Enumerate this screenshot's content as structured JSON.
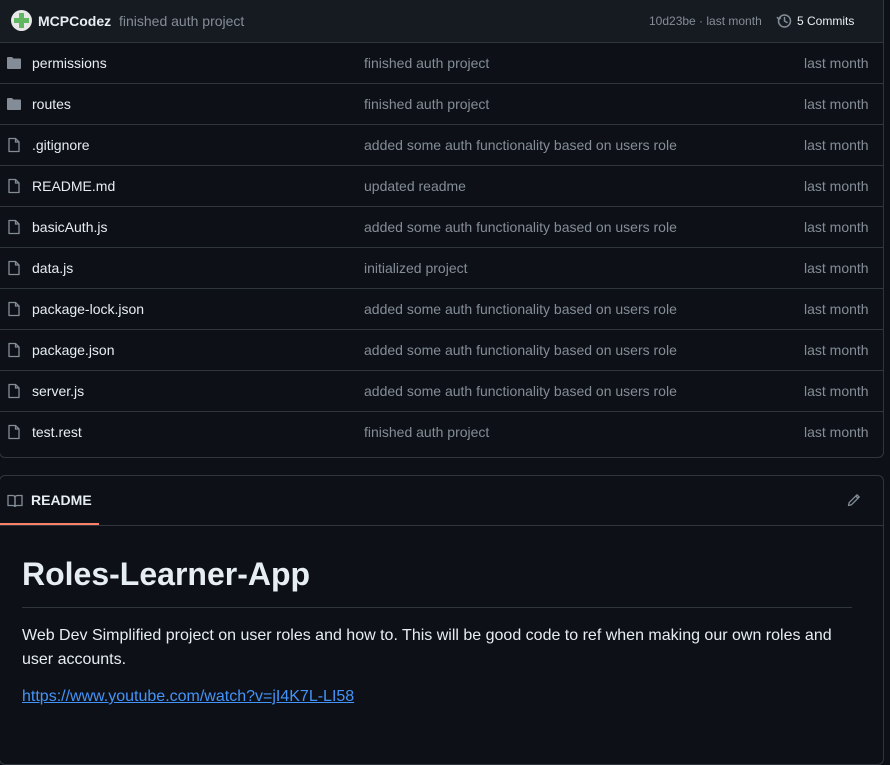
{
  "commit_bar": {
    "author": "MCPCodez",
    "message": "finished auth project",
    "meta": "10d23be · last month",
    "commits_label": "5 Commits"
  },
  "files": [
    {
      "type": "folder",
      "name": "permissions",
      "message": "finished auth project",
      "time": "last month"
    },
    {
      "type": "folder",
      "name": "routes",
      "message": "finished auth project",
      "time": "last month"
    },
    {
      "type": "file",
      "name": ".gitignore",
      "message": "added some auth functionality based on users role",
      "time": "last month"
    },
    {
      "type": "file",
      "name": "README.md",
      "message": "updated readme",
      "time": "last month"
    },
    {
      "type": "file",
      "name": "basicAuth.js",
      "message": "added some auth functionality based on users role",
      "time": "last month"
    },
    {
      "type": "file",
      "name": "data.js",
      "message": "initialized project",
      "time": "last month"
    },
    {
      "type": "file",
      "name": "package-lock.json",
      "message": "added some auth functionality based on users role",
      "time": "last month"
    },
    {
      "type": "file",
      "name": "package.json",
      "message": "added some auth functionality based on users role",
      "time": "last month"
    },
    {
      "type": "file",
      "name": "server.js",
      "message": "added some auth functionality based on users role",
      "time": "last month"
    },
    {
      "type": "file",
      "name": "test.rest",
      "message": "finished auth project",
      "time": "last month"
    }
  ],
  "readme": {
    "tab_label": "README",
    "title": "Roles-Learner-App",
    "paragraph": "Web Dev Simplified project on user roles and how to. This will be good code to ref when making our own roles and user accounts.",
    "link": "https://www.youtube.com/watch?v=jI4K7L-LI58"
  },
  "colors": {
    "background": "#0d1117",
    "border": "#30363d",
    "muted_text": "#848d97",
    "link": "#4493f8",
    "tab_underline": "#f78166"
  }
}
